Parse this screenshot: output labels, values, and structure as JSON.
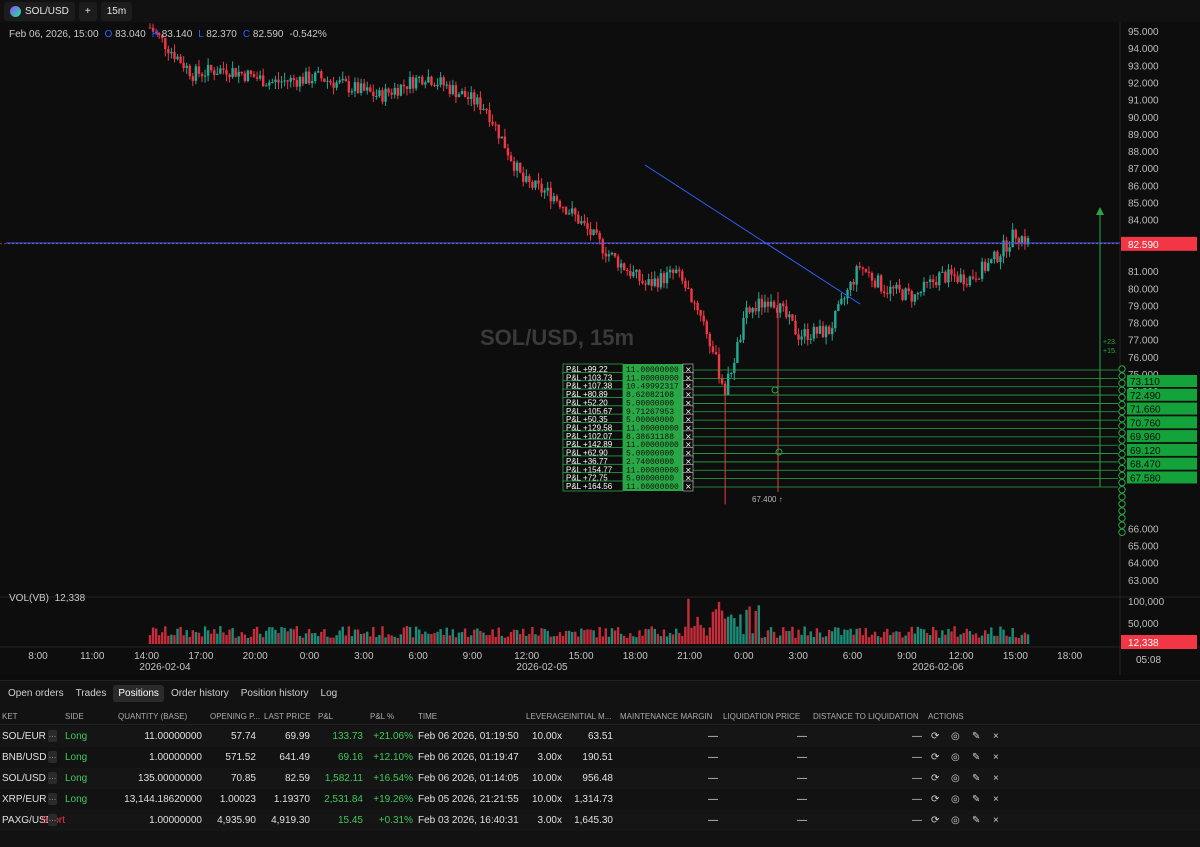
{
  "toolbar": {
    "symbol": "SOL/USD",
    "add": "+",
    "interval": "15m"
  },
  "legend": {
    "date": "Feb 06, 2026, 15:00",
    "o_label": "O",
    "o": "83.040",
    "h_label": "H",
    "h": "83.140",
    "l_label": "L",
    "l": "82.370",
    "c_label": "C",
    "c": "82.590",
    "change": "-0.542%"
  },
  "volume": {
    "label": "VOL(VB)",
    "value": "12,338"
  },
  "watermark": "SOL/USD, 15m",
  "colors": {
    "up": "#22ab94",
    "down": "#f23645",
    "trend": "#2962ff",
    "badge": "#f23645",
    "position": "#29a745"
  },
  "price_axis": {
    "ticks": [
      "95.000",
      "94.000",
      "93.000",
      "92.000",
      "91.000",
      "90.000",
      "89.000",
      "88.000",
      "87.000",
      "86.000",
      "85.000",
      "84.000",
      "81.000",
      "80.000",
      "79.000",
      "78.000",
      "77.000",
      "76.000",
      "75.000",
      "74.000",
      "66.000",
      "65.000",
      "64.000",
      "63.000"
    ],
    "current": "82.590"
  },
  "entry_labels": [
    "73.110",
    "72.490",
    "71.660",
    "70.760",
    "69.960",
    "69.120",
    "68.470",
    "67.580"
  ],
  "volume_axis": {
    "ticks": [
      "100,000",
      "50,000"
    ],
    "current": "12,338"
  },
  "time_axis": {
    "ticks": [
      "8:00",
      "11:00",
      "14:00",
      "17:00",
      "20:00",
      "0:00",
      "3:00",
      "6:00",
      "9:00",
      "12:00",
      "15:00",
      "18:00",
      "21:00",
      "0:00",
      "3:00",
      "6:00",
      "9:00",
      "12:00",
      "15:00",
      "18:00"
    ],
    "dates": [
      "2026-02-04",
      "2026-02-05",
      "2026-02-06"
    ],
    "clock": "05:08"
  },
  "low_marker": "67.400",
  "measure": {
    "line1": "+23.",
    "line2": "+15."
  },
  "pnl_orders": [
    {
      "pnl": "P&L +99.22",
      "qty": "11.00000000"
    },
    {
      "pnl": "P&L +103.73",
      "qty": "11.00000000"
    },
    {
      "pnl": "P&L +107.38",
      "qty": "10.49992317"
    },
    {
      "pnl": "P&L +80.89",
      "qty": "8.62082108"
    },
    {
      "pnl": "P&L +52.20",
      "qty": "5.00000000"
    },
    {
      "pnl": "P&L +105.67",
      "qty": "9.71267953"
    },
    {
      "pnl": "P&L +50.35",
      "qty": "5.00000000"
    },
    {
      "pnl": "P&L +129.58",
      "qty": "11.00000000"
    },
    {
      "pnl": "P&L +102.07",
      "qty": "8.38631188"
    },
    {
      "pnl": "P&L +142.89",
      "qty": "11.00000000"
    },
    {
      "pnl": "P&L +62.90",
      "qty": "5.00000000"
    },
    {
      "pnl": "P&L +36.77",
      "qty": "2.74000000"
    },
    {
      "pnl": "P&L +154.77",
      "qty": "11.00000000"
    },
    {
      "pnl": "P&L +72.75",
      "qty": "5.00000000"
    },
    {
      "pnl": "P&L +164.56",
      "qty": "11.00000000"
    }
  ],
  "tabs": [
    "Open orders",
    "Trades",
    "Positions",
    "Order history",
    "Position history",
    "Log"
  ],
  "active_tab": "Positions",
  "columns": [
    "KET",
    "SIDE",
    "QUANTITY (BASE)",
    "OPENING P...",
    "LAST PRICE",
    "P&L",
    "P&L %",
    "TIME",
    "LEVERAGE",
    "INITIAL M...",
    "MAINTENANCE MARGIN",
    "LIQUIDATION PRICE",
    "DISTANCE TO LIQUIDATION",
    "ACTIONS"
  ],
  "positions": [
    {
      "market": "SOL/EUR",
      "side": "Long",
      "qty": "11.00000000",
      "open": "57.74",
      "last": "69.99",
      "pnl": "133.73",
      "pnl_pct": "+21.06%",
      "time": "Feb 06 2026, 01:19:50",
      "lev": "10.00x",
      "im": "63.51",
      "mm": "—",
      "liq": "—"
    },
    {
      "market": "BNB/USD",
      "side": "Long",
      "qty": "1.00000000",
      "open": "571.52",
      "last": "641.49",
      "pnl": "69.16",
      "pnl_pct": "+12.10%",
      "time": "Feb 06 2026, 01:19:47",
      "lev": "3.00x",
      "im": "190.51",
      "mm": "—",
      "liq": "—"
    },
    {
      "market": "SOL/USD",
      "side": "Long",
      "qty": "135.00000000",
      "open": "70.85",
      "last": "82.59",
      "pnl": "1,582.11",
      "pnl_pct": "+16.54%",
      "time": "Feb 06 2026, 01:14:05",
      "lev": "10.00x",
      "im": "956.48",
      "mm": "—",
      "liq": "—"
    },
    {
      "market": "XRP/EUR",
      "side": "Long",
      "qty": "13,144.18620000",
      "open": "1.00023",
      "last": "1.19370",
      "pnl": "2,531.84",
      "pnl_pct": "+19.26%",
      "time": "Feb 05 2026, 21:21:55",
      "lev": "10.00x",
      "im": "1,314.73",
      "mm": "—",
      "liq": "—"
    },
    {
      "market": "PAXG/USD",
      "side": "Short",
      "qty": "1.00000000",
      "open": "4,935.90",
      "last": "4,919.30",
      "pnl": "15.45",
      "pnl_pct": "+0.31%",
      "time": "Feb 03 2026, 16:40:31",
      "lev": "3.00x",
      "im": "1,645.30",
      "mm": "—",
      "liq": "—"
    }
  ],
  "actions": {
    "dash": "—",
    "reverse": "⟳",
    "target": "◎",
    "edit": "✎",
    "close": "×"
  }
}
